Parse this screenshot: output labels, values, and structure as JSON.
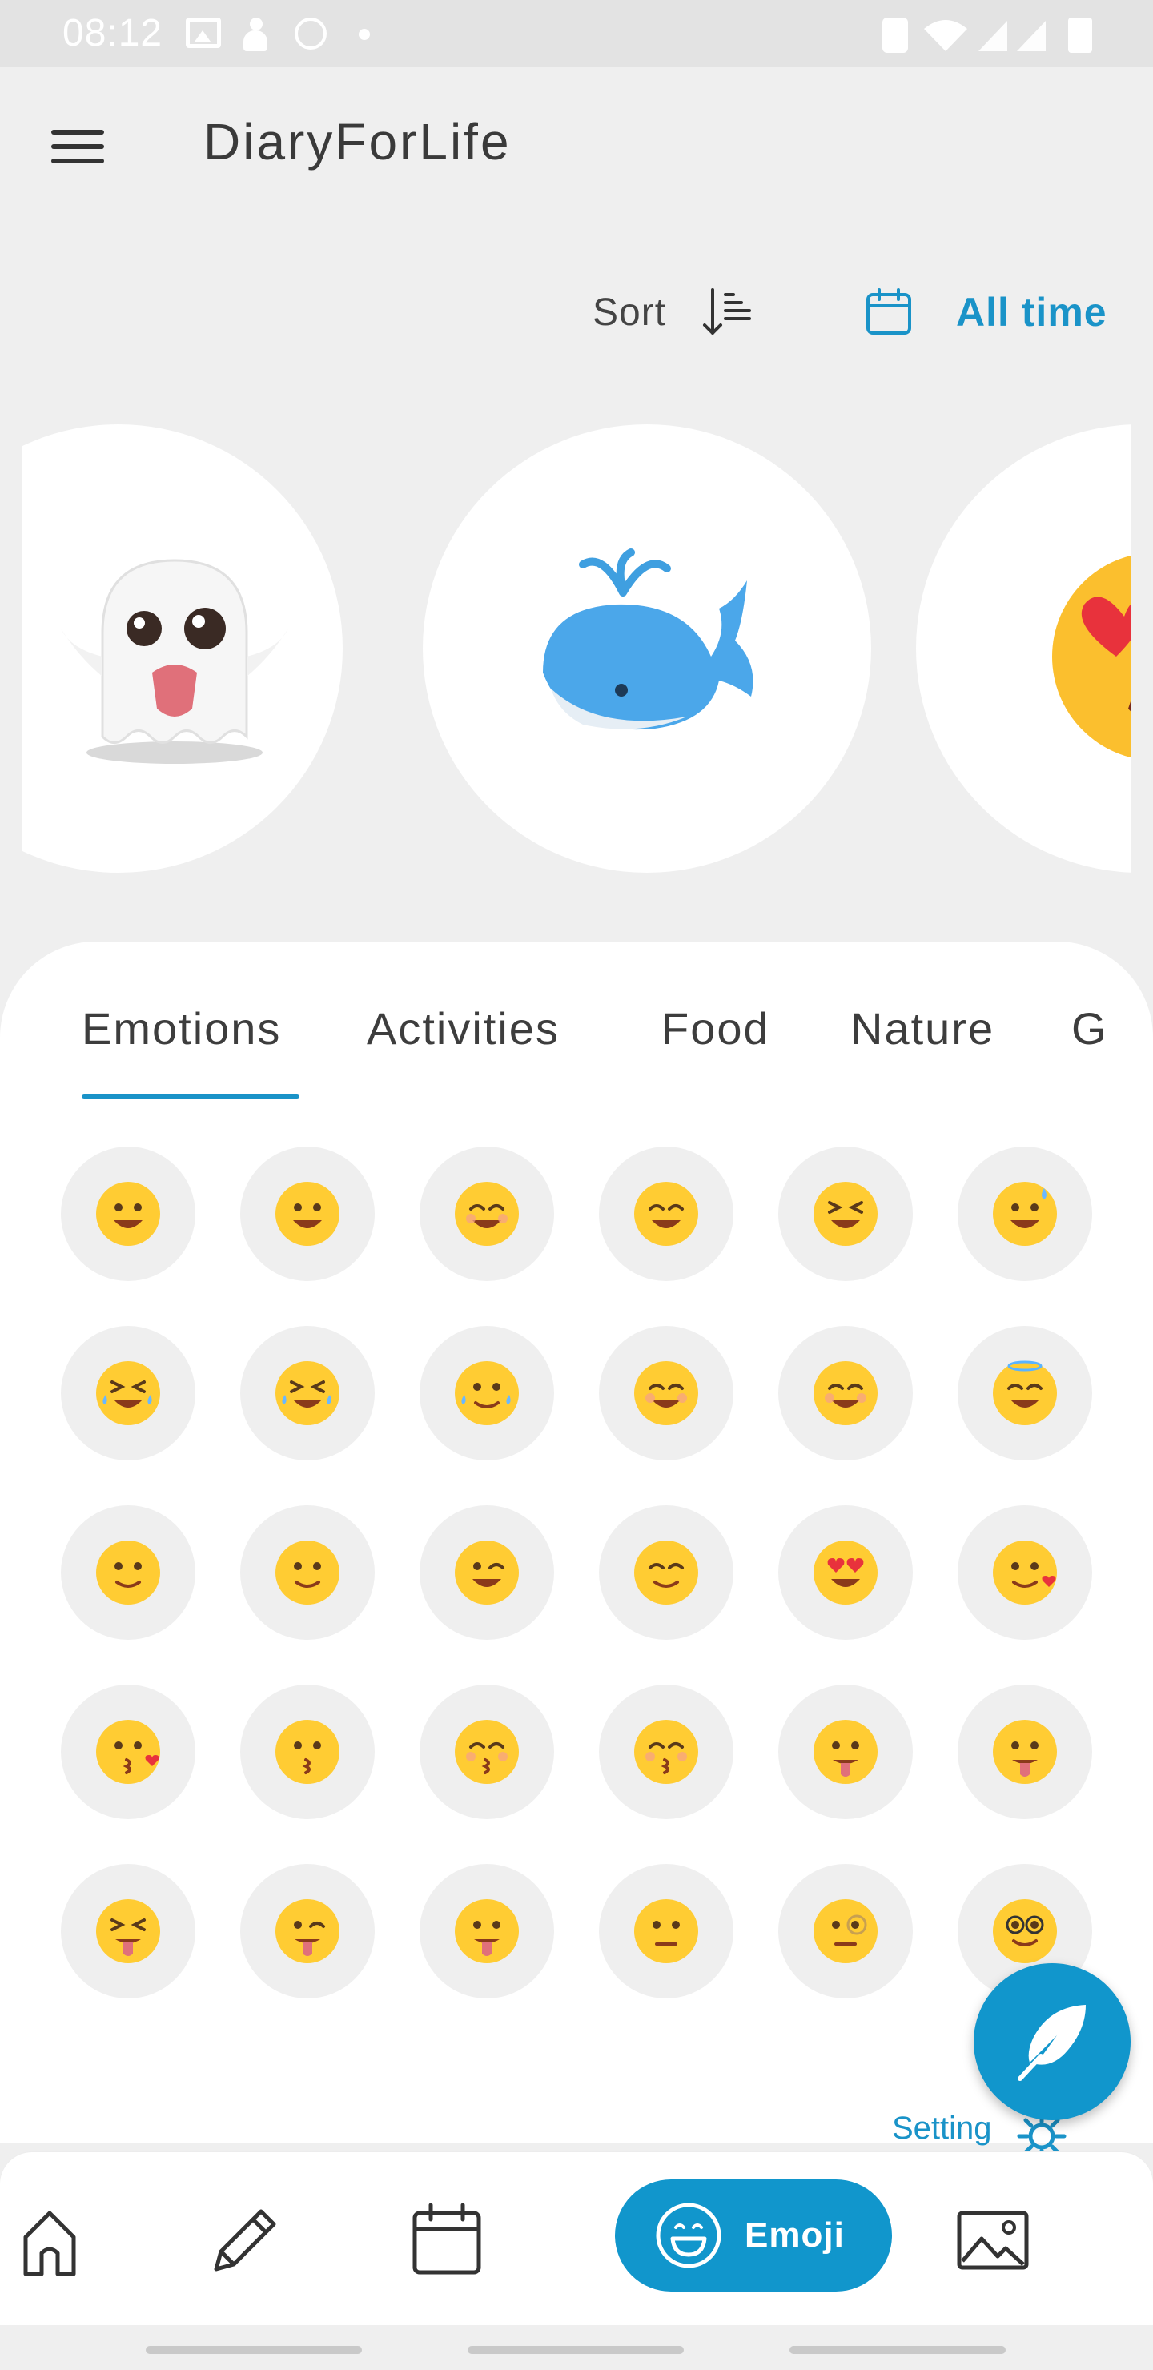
{
  "status_bar": {
    "time": "08:12"
  },
  "app": {
    "title": "DiaryForLife"
  },
  "toolbar": {
    "sort_label": "Sort",
    "range_label": "All time"
  },
  "featured": [
    {
      "name": "ghost-emoji"
    },
    {
      "name": "spouting-whale-emoji"
    },
    {
      "name": "heart-eyes-emoji"
    }
  ],
  "tabs": [
    {
      "label": "Emotions",
      "active": true
    },
    {
      "label": "Activities",
      "active": false
    },
    {
      "label": "Food",
      "active": false
    },
    {
      "label": "Nature",
      "active": false
    },
    {
      "label": "G",
      "active": false
    }
  ],
  "emoji_rows": [
    [
      "grinning-face",
      "grinning-big-eyes",
      "grinning-smiling-eyes",
      "beaming-face",
      "grinning-squinting",
      "grinning-sweat"
    ],
    [
      "tears-of-joy",
      "rolling-laughing",
      "slightly-smiling-tear",
      "smiling-blush",
      "smiling-eyes",
      "halo-face"
    ],
    [
      "slightly-smiling",
      "upside-down-face",
      "winking-face",
      "relieved-face",
      "heart-eyes",
      "smiling-hearts"
    ],
    [
      "kissing-heart",
      "kissing-face",
      "kissing-smiling-eyes",
      "kissing-closed-eyes",
      "savoring-food",
      "tongue-out"
    ],
    [
      "squinting-tongue",
      "winking-tongue",
      "zany-face",
      "raised-eyebrow",
      "monocle-face",
      "nerd-face"
    ]
  ],
  "fab": {
    "icon": "feather-icon"
  },
  "setting": {
    "label": "Setting"
  },
  "bottom_nav": {
    "items": [
      "home-icon",
      "pencil-icon",
      "calendar-icon",
      "emoji-icon",
      "image-icon"
    ],
    "emoji_label": "Emoji",
    "active": "emoji"
  },
  "colors": {
    "accent": "#1196cc",
    "background": "#efefef",
    "emoji_yellow": "#ffcc33"
  }
}
